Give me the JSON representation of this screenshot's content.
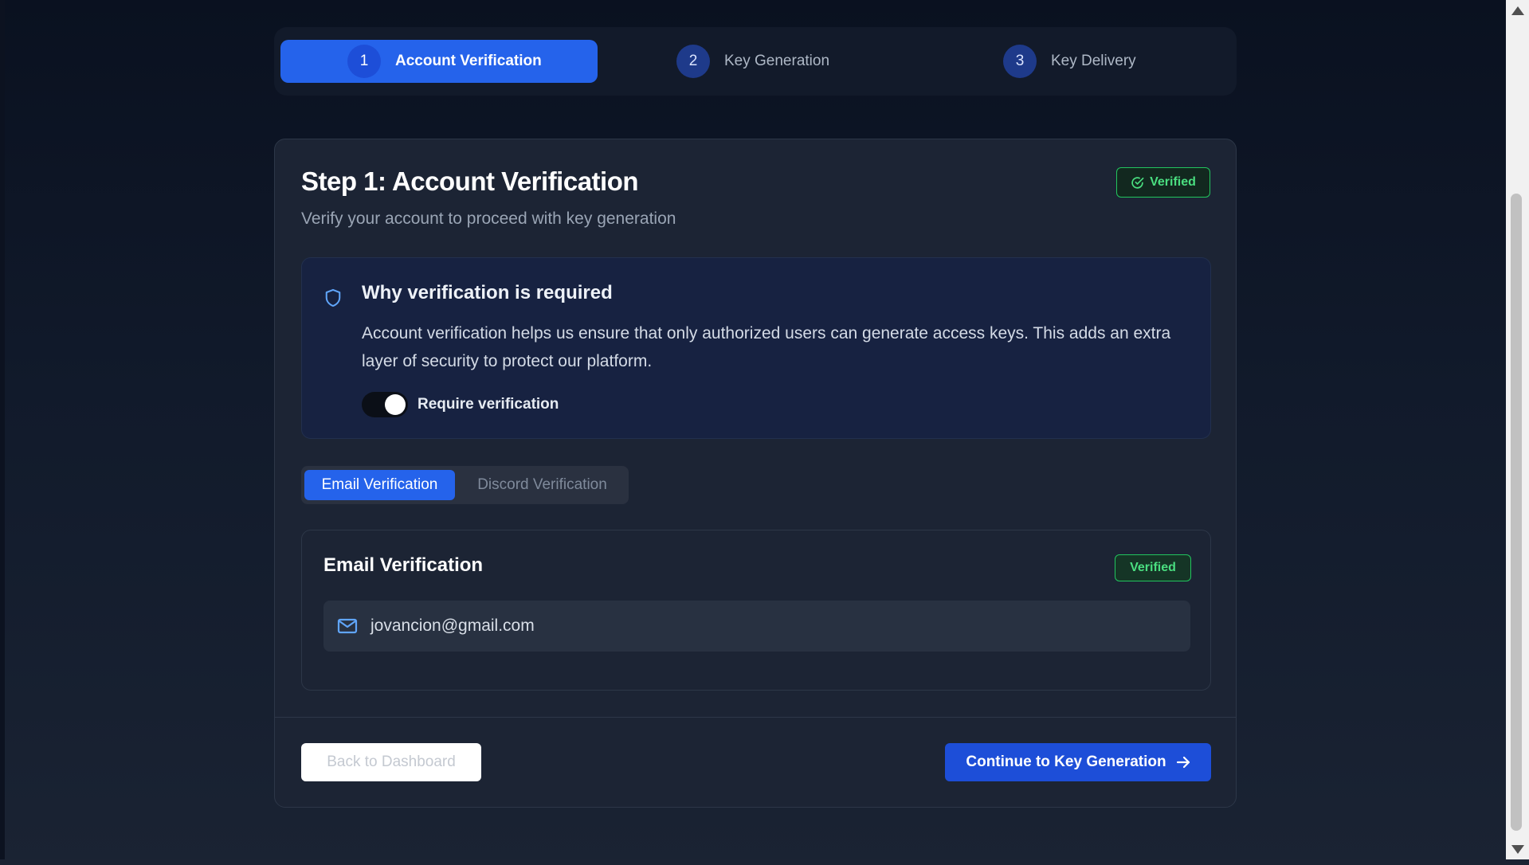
{
  "stepper": {
    "steps": [
      {
        "number": "1",
        "label": "Account Verification",
        "active": true
      },
      {
        "number": "2",
        "label": "Key Generation",
        "active": false
      },
      {
        "number": "3",
        "label": "Key Delivery",
        "active": false
      }
    ]
  },
  "card": {
    "title": "Step 1: Account Verification",
    "subtitle": "Verify your account to proceed with key generation",
    "status_badge": "Verified"
  },
  "info": {
    "icon": "shield-icon",
    "title": "Why verification is required",
    "text": "Account verification helps us ensure that only authorized users can generate access keys. This adds an extra layer of security to protect our platform.",
    "toggle_label": "Require verification",
    "toggle_on": true
  },
  "tabs": [
    {
      "label": "Email Verification",
      "active": true
    },
    {
      "label": "Discord Verification",
      "active": false
    }
  ],
  "email_panel": {
    "title": "Email Verification",
    "badge": "Verified",
    "icon": "mail-icon",
    "email": "jovancion@gmail.com"
  },
  "footer": {
    "back_label": "Back to Dashboard",
    "continue_label": "Continue to Key Generation"
  },
  "colors": {
    "accent": "#2563eb",
    "success": "#4ade80",
    "background": "#0a1120",
    "card": "#1c2434"
  }
}
